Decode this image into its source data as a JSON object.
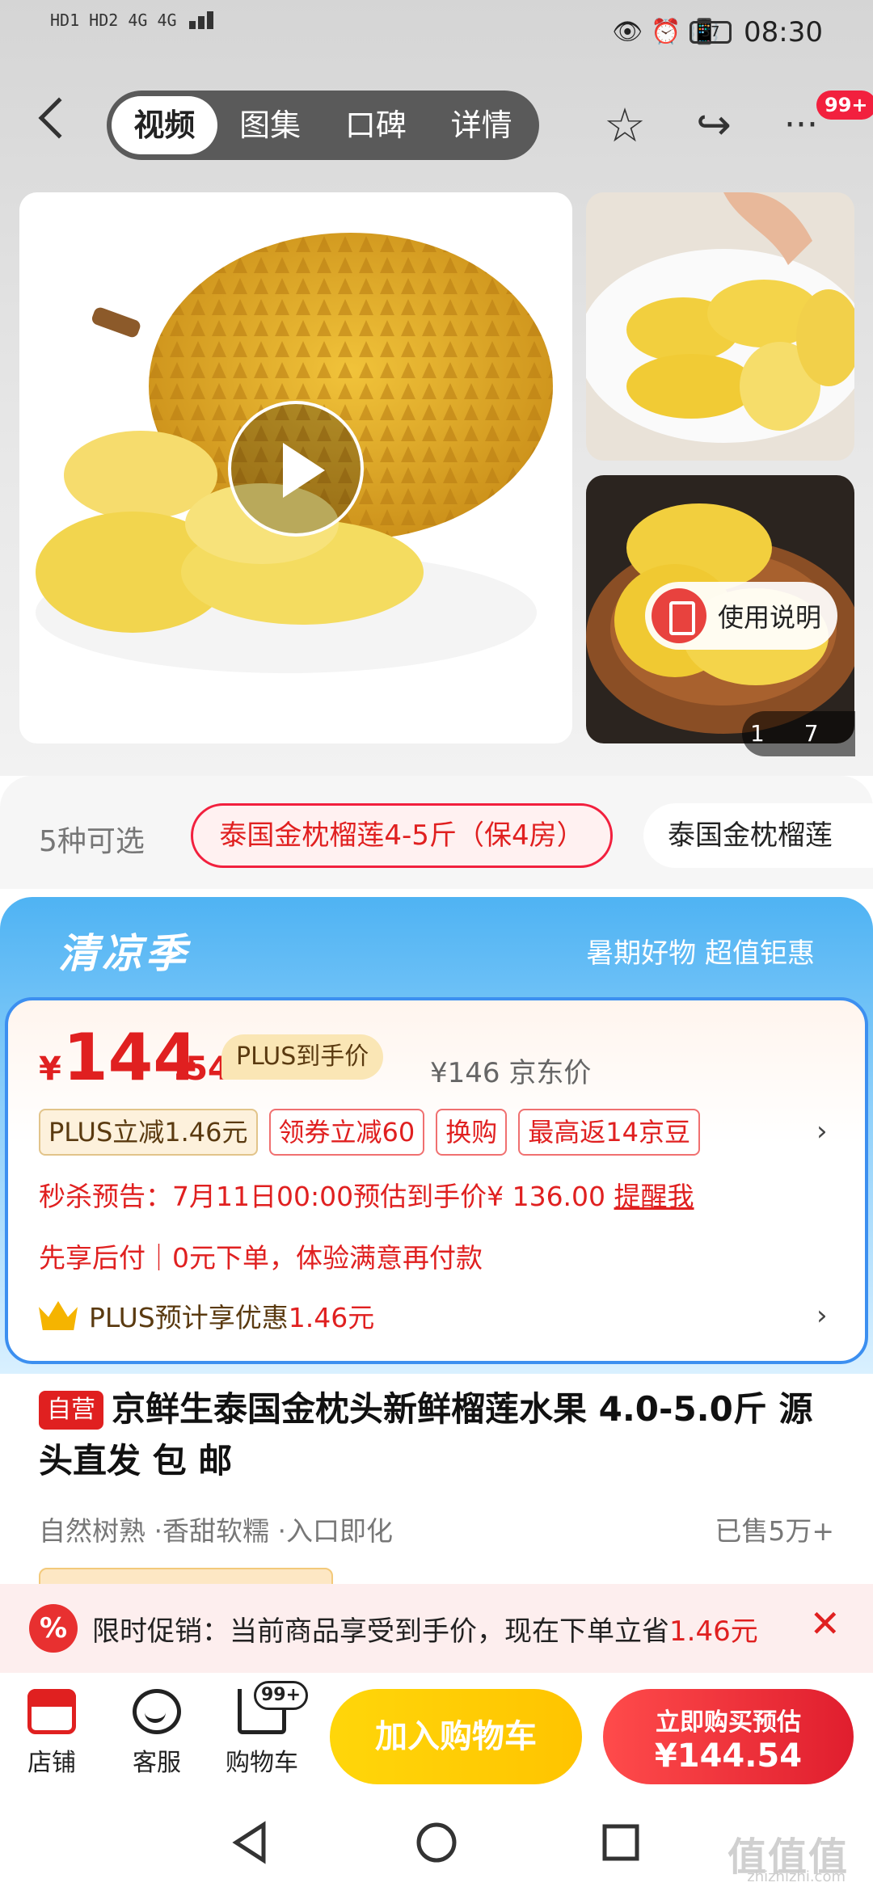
{
  "status_bar": {
    "left": "HD1 HD2 4G 4G",
    "battery": "37",
    "time": "08:30"
  },
  "nav_tabs": [
    {
      "label": "视频"
    },
    {
      "label": "图集"
    },
    {
      "label": "口碑"
    },
    {
      "label": "详情"
    }
  ],
  "header": {
    "more_badge": "99+"
  },
  "gallery": {
    "usage_label": "使用说明",
    "page_current": "1",
    "page_total": "7"
  },
  "variants": {
    "count_label": "5种可选",
    "selected": "泰国金枕榴莲4-5斤（保4房）",
    "other": "泰国金枕榴莲"
  },
  "promo_banner": {
    "title": "清凉季",
    "subtitle": "暑期好物 超值钜惠"
  },
  "price": {
    "currency": "¥",
    "integer": "144",
    "decimal": ".54",
    "plus_tag": "PLUS到手价",
    "jd_price": "¥146 京东价",
    "chips": [
      "PLUS立减1.46元",
      "领券立减60",
      "换购",
      "最高返14京豆"
    ],
    "seckill": "秒杀预告：7月11日00:00预估到手价¥ 136.00",
    "seckill_action": "提醒我",
    "pay_later": "先享后付｜0元下单，体验满意再付款",
    "plus_prefix": "PLUS预计享优惠",
    "plus_amount": "1.46元"
  },
  "product": {
    "self_tag": "自营",
    "title": "京鲜生泰国金枕头新鲜榴莲水果 4.0-5.0斤 源头直发 包 邮",
    "tags": "自然树熟 ·香甜软糯 ·入口即化",
    "sold": "已售5万+"
  },
  "notice": {
    "prefix": "限时促销：当前商品享受到手价，现在下单立省",
    "amount": "1.46元",
    "icon_text": "%"
  },
  "bottom_bar": {
    "shop": "店铺",
    "service": "客服",
    "cart": "购物车",
    "cart_badge": "99+",
    "add_to_cart": "加入购物车",
    "buy_line1": "立即购买预估",
    "buy_line2": "¥144.54"
  },
  "watermark": {
    "main": "值值值",
    "sub": "zhizhizhi.com"
  },
  "colors": {
    "accent": "#e02020",
    "promo_blue": "#4fb3f3",
    "cart_yellow": "#ffcc00"
  }
}
